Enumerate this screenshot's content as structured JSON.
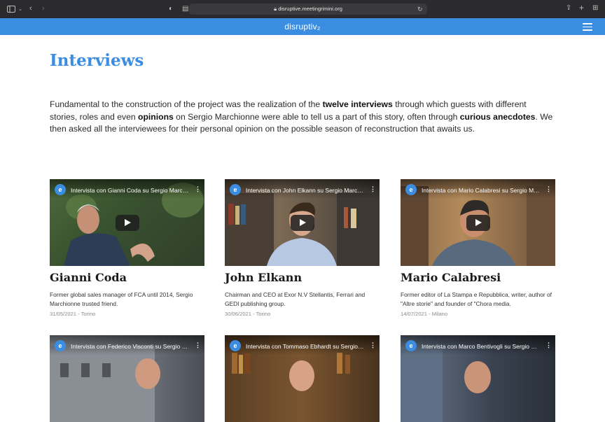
{
  "browser": {
    "url": "disruptive.meetingrimini.org"
  },
  "site": {
    "brand": "disruptiv₂",
    "accent_color": "#3b8de2"
  },
  "main": {
    "title": "Interviews",
    "intro": {
      "p1": "Fundamental to the construction of the project was the realization of the ",
      "b1": "twelve interviews",
      "p2": " through which guests with different stories, roles and even ",
      "b2": "opinions",
      "p3": " on Sergio Marchionne were able to tell us a part of this story, often through ",
      "b3": "curious anecdotes",
      "p4": ". We then asked all the interviewees for their personal opinion on the possible season of reconstruction that awaits us."
    },
    "interviews": [
      {
        "video_title": "Intervista con Gianni Coda su Sergio Marchionne",
        "name": "Gianni Coda",
        "description": "Former global sales manager of FCA until 2014, Sergio Marchionne trusted friend.",
        "meta": "31/05/2021 - Torino"
      },
      {
        "video_title": "Intervista con John Elkann su Sergio Marchionne",
        "name": "John Elkann",
        "description": "Chairman and CEO at Exor N.V Stellantis, Ferrari and GEDI publishing group.",
        "meta": "30/06/2021 - Torino"
      },
      {
        "video_title": "Intervista con Mario Calabresi su Sergio Marchionne",
        "name": "Mario Calabresi",
        "description": "Former editor of La Stampa e Repubblica, writer, author of \"Altre storie\" and founder of \"Chora media.",
        "meta": "14/07/2021 - Milano"
      },
      {
        "video_title": "Intervista con Federico Visconti su Sergio Marchionne"
      },
      {
        "video_title": "Intervista con Tommaso Ebhardt su Sergio Marchionne"
      },
      {
        "video_title": "Intervista con Marco Bentivogli su Sergio Marchionne"
      }
    ]
  }
}
